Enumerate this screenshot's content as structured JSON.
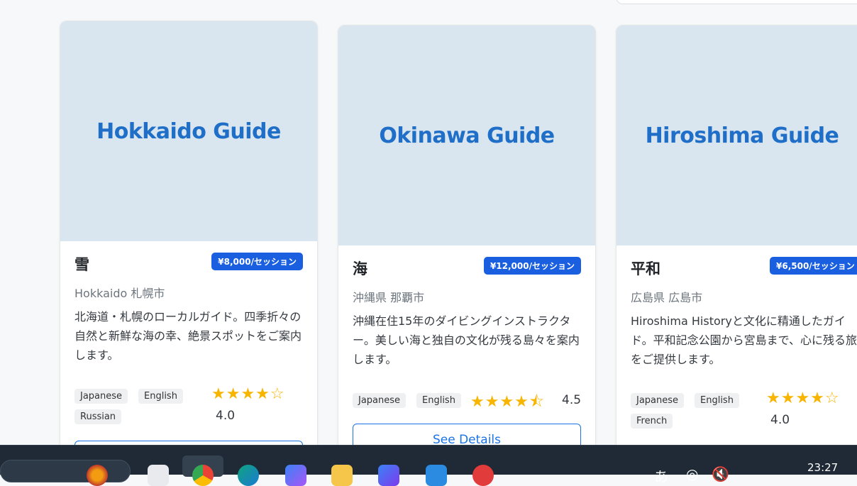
{
  "cards": [
    {
      "image_text": "Hokkaido Guide",
      "title": "雪",
      "price": "¥8,000/セッション",
      "location": "Hokkaido 札幌市",
      "description": "北海道・札幌のローカルガイド。四季折々の自然と新鮮な海の幸、絶景スポットをご案内します。",
      "languages": [
        "Japanese",
        "English",
        "Russian"
      ],
      "stars_display": "★★★★☆",
      "rating": "4.0",
      "button_label": ""
    },
    {
      "image_text": "Okinawa Guide",
      "title": "海",
      "price": "¥12,000/セッション",
      "location": "沖縄県 那覇市",
      "description": "沖縄在住15年のダイビングインストラクター。美しい海と独自の文化が残る島々を案内します。",
      "languages": [
        "Japanese",
        "English"
      ],
      "stars_display": "★★★★⯪",
      "rating": "4.5",
      "button_label": "See Details"
    },
    {
      "image_text": "Hiroshima Guide",
      "title": "平和",
      "price": "¥6,500/セッション",
      "location": "広島県 広島市",
      "description": "Hiroshima Historyと文化に精通したガイド。平和記念公園から宮島まで、心に残る旅をご提供します。",
      "languages": [
        "Japanese",
        "English",
        "French"
      ],
      "stars_display": "★★★★☆",
      "rating": "4.0",
      "button_label": ""
    }
  ],
  "taskbar": {
    "clock": "23:27",
    "tray_glyphs": [
      "あ",
      "◎",
      "🔇"
    ]
  },
  "colors": {
    "accent": "#1a73e8",
    "price_badge": "#1a5fe0",
    "card_image_bg": "#d9e5ef",
    "star": "#f7b500",
    "taskbar": "#1f2a36"
  }
}
